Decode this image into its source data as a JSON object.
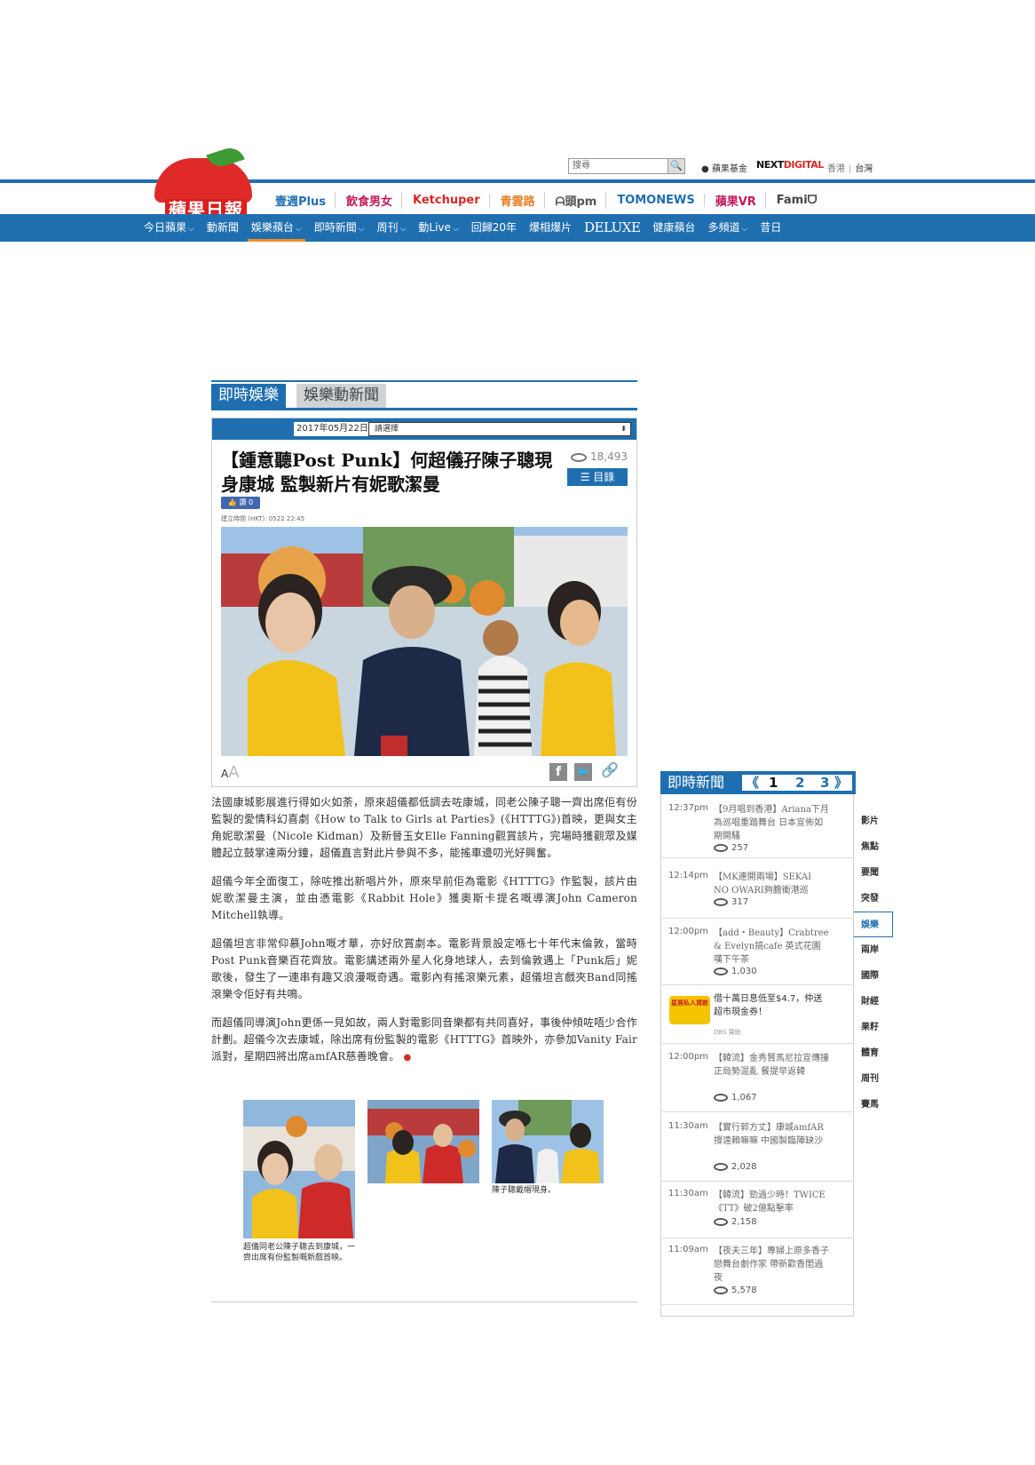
{
  "header": {
    "logo_text": "蘋果日報",
    "search_placeholder": "搜尋",
    "search_button": "🔍",
    "foundation_link": "蘋果基金",
    "nextdigital_a": "NEXT",
    "nextdigital_b": "DIGITAL",
    "region_hk": "香港",
    "region_tw": "台灣",
    "partners": [
      "壹週Plus",
      "飲食男女",
      "Ketchuper",
      "青雲路",
      "ᗩ頭pm",
      "TOMONEWS",
      "蘋果VR",
      "Famiᗜ"
    ],
    "partner_colors": [
      "#1f6fb0",
      "#c2185b",
      "#d62a28",
      "#e67e22",
      "#555555",
      "#1f6fb0",
      "#c2185b",
      "#444444"
    ]
  },
  "nav": {
    "items": [
      {
        "label": "今日蘋果",
        "chev": "⌵"
      },
      {
        "label": "動新聞",
        "chev": ""
      },
      {
        "label": "娛樂蘋台",
        "chev": "⌵"
      },
      {
        "label": "即時新聞",
        "chev": "⌵"
      },
      {
        "label": "周刊",
        "chev": "⌵"
      },
      {
        "label": "動Live",
        "chev": "⌵"
      },
      {
        "label": "回歸20年",
        "chev": ""
      },
      {
        "label": "爆相爆片",
        "chev": ""
      },
      {
        "label": "DELUXE",
        "chev": ""
      },
      {
        "label": "健康蘋台",
        "chev": ""
      },
      {
        "label": "多頻道",
        "chev": "⌵"
      },
      {
        "label": "昔日",
        "chev": ""
      }
    ]
  },
  "section_tabs": {
    "active": "即時娛樂",
    "inactive": "娛樂動新聞"
  },
  "article": {
    "date": "2017年05月22日",
    "select_value": "請選擇",
    "select_arrow": "⬍",
    "headline": "【鍾意聽Post Punk】何超儀孖陳子聰現身康城 監製新片有妮歌潔曼",
    "views": "18,493",
    "toc_label": "目錄",
    "like_label": "讚 0",
    "timestamp": "建立時間 (HKT): 0522 22:45",
    "font_small": "A",
    "font_big": "A",
    "share_fb": "f",
    "share_tw": "🐦",
    "share_link": "🔗",
    "paragraphs": [
      "法國康城影展進行得如火如荼，原來超儀都低調去咗康城，同老公陳子聰一齊出席佢有份監製的愛情科幻喜劇《How to Talk to Girls at Parties》(《HTTTG》)首映，更與女主角妮歌潔曼（Nicole Kidman）及新晉玉女Elle Fanning觀賞該片，完場時獲觀眾及媒體起立鼓掌達兩分鐘，超儀直言對此片參與不多，能搖車邊叨光好興奮。",
      "超儀今年全面復工，除咗推出新唱片外，原來早前佢為電影《HTTTG》作監製，該片由妮歌潔曼主演，並由憑電影《Rabbit Hole》獲奧斯卡提名嘅導演John Cameron Mitchell執導。",
      "超儀坦言非常仰慕John嘅才華，亦好欣賞劇本。電影背景設定喺七十年代末倫敦，當時Post Punk音樂百花齊放。電影講述兩外星人化身地球人，去到倫敦遇上「Punk后」妮歌後，發生了一連串有趣又浪漫嘅奇遇。電影內有搖滾樂元素，超儀坦言戲夾Band同搖滾樂令佢好有共鳴。",
      "而超儀同導演John更係一見如故，兩人對電影同音樂都有共同喜好，事後仲傾咗唔少合作計劃。超儀今次去康城，除出席有份監製的電影《HTTTG》首映外，亦參加Vanity Fair派對，星期四將出席amfAR慈善晚會。"
    ],
    "end_icon": "●",
    "captions": [
      "超儀同老公陳子聰去到康城，一齊出席有份監製嘅新戲首映。",
      "",
      "陳子聰戴帽現身。"
    ]
  },
  "sidebar": {
    "title": "即時新聞",
    "pager_prev": "《",
    "pager_pages": [
      "1",
      "2",
      "3"
    ],
    "pager_next": "》",
    "news": [
      {
        "time": "12:37pm",
        "headline": "【9月唱到香港】Ariana下月為巡唱重踏舞台 日本宣佈如期開騷",
        "views": "257"
      },
      {
        "time": "12:14pm",
        "headline": "【MK連開兩場】SEKAI NO OWARI夠膽衝港巡",
        "views": "317"
      },
      {
        "time": "12:00pm",
        "headline": "【add・Beauty】Crabtree & Evelyn搞cafe 英式花園嘆下午茶",
        "views": "1,030"
      },
      {
        "time": "",
        "headline": "借十萬日息低至$4.7，仲送超市現金券！",
        "sponsor": "DBS 贊助",
        "ad_logo": "星展私人貸款"
      },
      {
        "time": "12:00pm",
        "headline": "【韓流】金秀賢馬尼拉宣傳撞正局勢混亂 餐提早返韓",
        "views": "1,067"
      },
      {
        "time": "11:30am",
        "headline": "【實行郭方丈】康城amfAR撐遠賴嘛嘛 中國製臨陣缺沙",
        "views": "2,028"
      },
      {
        "time": "11:30am",
        "headline": "【韓流】勁過少時！TWICE《TT》破2億點擊率",
        "views": "2,158"
      },
      {
        "time": "11:09am",
        "headline": "【夜夫三年】專婦上原多香子戀舞台劇作家 帶新歡香閨過夜",
        "views": "5,578"
      }
    ],
    "categories": [
      "影片",
      "焦點",
      "要聞",
      "突發",
      "娛樂",
      "兩岸",
      "國際",
      "財經",
      "果籽",
      "體育",
      "周刊",
      "賽馬"
    ],
    "active_category": "娛樂"
  }
}
